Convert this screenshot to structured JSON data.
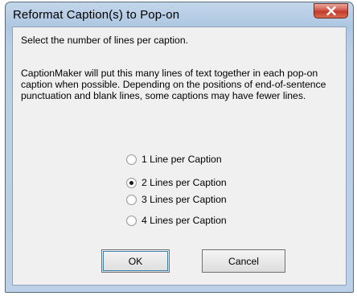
{
  "window": {
    "title": "Reformat Caption(s) to Pop-on",
    "close_icon": "close-icon"
  },
  "instruction": "Select the number of lines per caption.",
  "description": "CaptionMaker will put this many lines of text together in each pop-on caption when possible. Depending on the positions of end-of-sentence punctuation and blank lines, some captions may have fewer lines.",
  "options": [
    {
      "label": "1 Line per Caption",
      "selected": false
    },
    {
      "label": "2 Lines per Caption",
      "selected": true
    },
    {
      "label": "3 Lines per Caption",
      "selected": false
    },
    {
      "label": "4 Lines per Caption",
      "selected": false
    }
  ],
  "buttons": {
    "ok": "OK",
    "cancel": "Cancel"
  },
  "colors": {
    "close_button": "#c9463a",
    "title_bar": "#b9cfe6",
    "client_background": "#f0f0f0"
  }
}
